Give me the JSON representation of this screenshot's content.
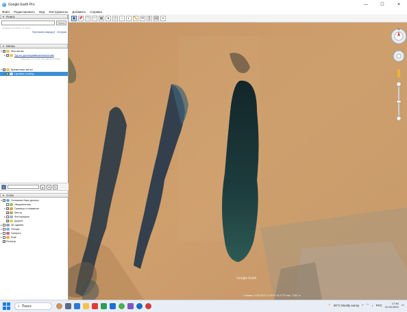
{
  "window": {
    "title": "Google Earth Pro",
    "minimize": "—",
    "maximize": "☐",
    "close": "✕"
  },
  "menu": [
    "Файл",
    "Редактировать",
    "Вид",
    "Инструменты",
    "Добавить",
    "Справка"
  ],
  "search_panel": {
    "header": "Поиск",
    "button": "Поиск",
    "hint": "например: 51.60511, 37.46.64",
    "route_link": "Проложить маршрут",
    "history_link": "История"
  },
  "places_panel": {
    "header": "Метки",
    "items": [
      {
        "label": "Мои метки",
        "checked": true
      },
      {
        "label": "Тур по достопримечательностям",
        "checked": true
      },
      {
        "label": "Временные метки",
        "checked": true
      },
      {
        "label": "Lgirailad_kooling",
        "checked": true
      }
    ],
    "sub_hint": "Убедитесь, что слой «3D здания» выбран"
  },
  "layers_panel": {
    "header": "Слои",
    "items": [
      {
        "label": "Основная база данных",
        "checked": true
      },
      {
        "label": "Уведомления",
        "checked": false
      },
      {
        "label": "Границы и названия",
        "checked": true
      },
      {
        "label": "Места",
        "checked": true
      },
      {
        "label": "Фотографии",
        "checked": false
      },
      {
        "label": "Дороги",
        "checked": true
      },
      {
        "label": "3D здания",
        "checked": false
      },
      {
        "label": "Погода",
        "checked": false
      },
      {
        "label": "Галерея",
        "checked": false
      },
      {
        "label": "Ещё",
        "checked": false
      },
      {
        "label": "Рельеф",
        "checked": true
      }
    ]
  },
  "map": {
    "status_text": "Снимки: 5.06.2023   11.46°N  14.27°E   выс. 1287 м",
    "watermark": "Google Earth",
    "compass_label": "N"
  },
  "taskbar": {
    "search_label": "Поиск",
    "weather": "26°C  Mostly sunny",
    "language": "РУС",
    "time": "17:46",
    "date": "21.09.2023"
  },
  "colors": {
    "selected": "#3d8fd6",
    "link": "#1a3f8f"
  }
}
